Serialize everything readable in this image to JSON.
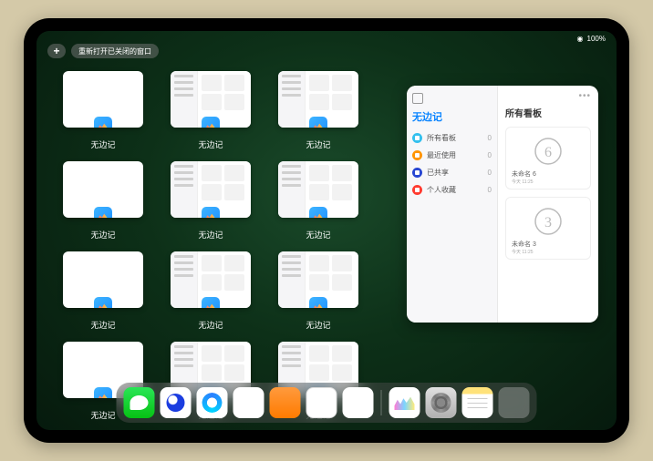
{
  "status": {
    "wifi": "◉",
    "battery": "100%"
  },
  "top": {
    "plus": "+",
    "reopen": "重新打开已关闭的窗口"
  },
  "app_label": "无边记",
  "windows": [
    {
      "style": "blank"
    },
    {
      "style": "sidebar"
    },
    {
      "style": "sidebar"
    },
    {
      "style": "blank"
    },
    {
      "style": "sidebar"
    },
    {
      "style": "sidebar"
    },
    {
      "style": "blank"
    },
    {
      "style": "sidebar"
    },
    {
      "style": "sidebar"
    },
    {
      "style": "blank"
    },
    {
      "style": "sidebar"
    },
    {
      "style": "sidebar"
    }
  ],
  "panel": {
    "left_title": "无边记",
    "right_title": "所有看板",
    "more": "•••",
    "rows": [
      {
        "label": "所有看板",
        "count": "0",
        "color": "blue"
      },
      {
        "label": "最近使用",
        "count": "0",
        "color": "orange"
      },
      {
        "label": "已共享",
        "count": "0",
        "color": "navy"
      },
      {
        "label": "个人收藏",
        "count": "0",
        "color": "red"
      }
    ],
    "boards": [
      {
        "name": "未命名 6",
        "date": "今天 11:25",
        "digit": "6"
      },
      {
        "name": "未命名 3",
        "date": "今天 11:25",
        "digit": "3"
      }
    ]
  },
  "dock": {
    "apps": [
      {
        "name": "wechat"
      },
      {
        "name": "quark"
      },
      {
        "name": "qqbrowser"
      },
      {
        "name": "play"
      },
      {
        "name": "books"
      },
      {
        "name": "dice"
      },
      {
        "name": "obsidian"
      }
    ],
    "recent": [
      {
        "name": "freeform"
      },
      {
        "name": "settings"
      },
      {
        "name": "notes"
      },
      {
        "name": "library"
      }
    ]
  }
}
